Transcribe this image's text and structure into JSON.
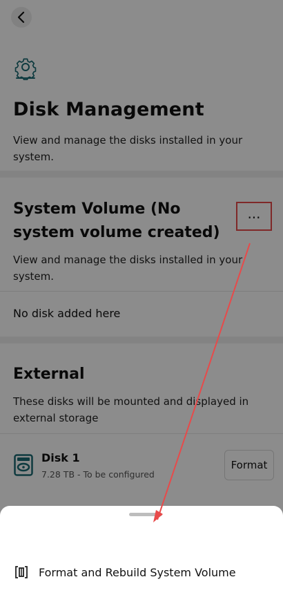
{
  "header": {
    "back_icon": "chevron-left-icon"
  },
  "page": {
    "icon": "gear-icon",
    "title": "Disk Management",
    "description": "View and manage the disks installed in your system."
  },
  "system_volume": {
    "title": "System Volume (No system volume created)",
    "description": "View and manage the disks installed in your system.",
    "more_label": "...",
    "empty_text": "No disk added here"
  },
  "external": {
    "title": "External",
    "description": "These disks will be mounted and displayed in external storage",
    "disks": [
      {
        "name": "Disk 1",
        "detail": "7.28 TB - To be configured",
        "action_label": "Format",
        "icon": "hard-disk-icon"
      }
    ]
  },
  "bottom_sheet": {
    "items": [
      {
        "label": "Format and Rebuild System Volume",
        "icon": "format-rebuild-icon"
      }
    ]
  },
  "colors": {
    "highlight": "#e84a4a",
    "accent_teal": "#1b6b73"
  }
}
